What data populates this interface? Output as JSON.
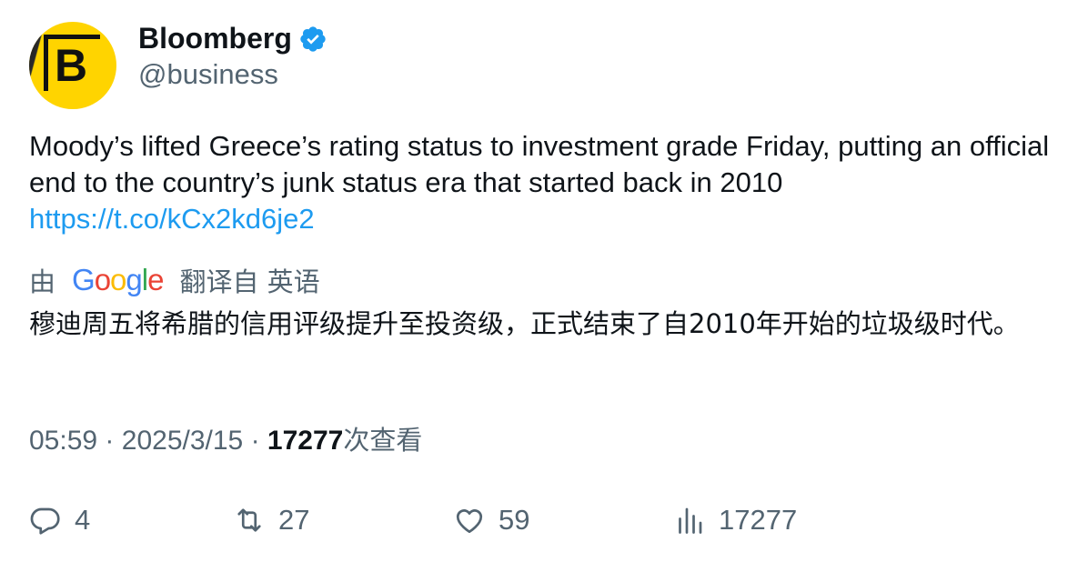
{
  "author": {
    "display_name": "Bloomberg",
    "handle": "@business",
    "avatar_letter": "B",
    "verified": true,
    "avatar_color": "#ffd400",
    "verified_color": "#1d9bf0"
  },
  "tweet": {
    "text": "Moody’s lifted Greece’s rating status to investment grade Friday, putting an official end to the country’s junk status era that started back in 2010",
    "link": "https://t.co/kCx2kd6je2"
  },
  "translation": {
    "prefix": "由",
    "provider": "Google",
    "suffix": "翻译自 英语",
    "text": "穆迪周五将希腊的信用评级提升至投资级，正式结束了自2010年开始的垃圾级时代。"
  },
  "meta": {
    "time": "05:59",
    "date": "2025/3/15",
    "separator": "·",
    "views_count": "17277",
    "views_label": "次查看"
  },
  "actions": {
    "replies": "4",
    "retweets": "27",
    "likes": "59",
    "views": "17277"
  },
  "colors": {
    "text_secondary": "#536471",
    "link": "#1d9bf0",
    "google_blue": "#4285f4",
    "google_red": "#ea4335",
    "google_yellow": "#fbbc05",
    "google_green": "#34a853"
  }
}
